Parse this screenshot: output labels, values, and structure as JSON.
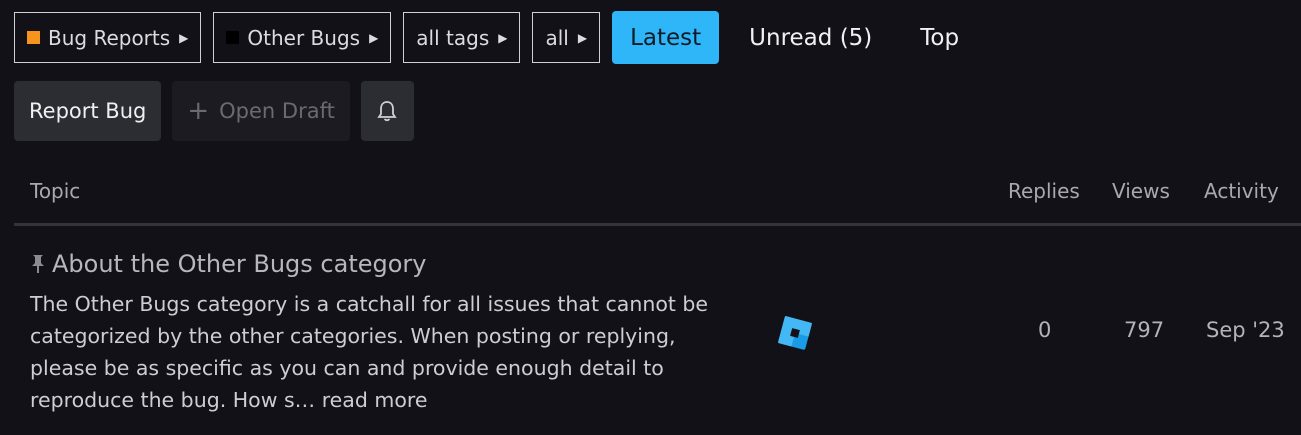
{
  "breadcrumbs": [
    {
      "label": "Bug Reports",
      "color": "#f7941d"
    },
    {
      "label": "Other Bugs",
      "color": "#000000"
    },
    {
      "label": "all tags"
    },
    {
      "label": "all"
    }
  ],
  "tabs": [
    {
      "label": "Latest",
      "active": true
    },
    {
      "label": "Unread (5)"
    },
    {
      "label": "Top"
    }
  ],
  "actions": {
    "report_label": "Report Bug",
    "draft_label": "Open Draft",
    "bell_icon": "bell-icon"
  },
  "table": {
    "columns": {
      "topic": "Topic",
      "replies": "Replies",
      "views": "Views",
      "activity": "Activity"
    },
    "rows": [
      {
        "title": "About the Other Bugs category",
        "excerpt": "The Other Bugs category is a catchall for all issues that cannot be categorized by the other categories. When posting or replying, please be as specific as you can and provide enough detail to reproduce the bug. How s…",
        "read_more": "read more",
        "replies": "0",
        "views": "797",
        "activity": "Sep '23"
      }
    ]
  },
  "colors": {
    "accent": "#2eb6f8",
    "background": "#111117"
  }
}
